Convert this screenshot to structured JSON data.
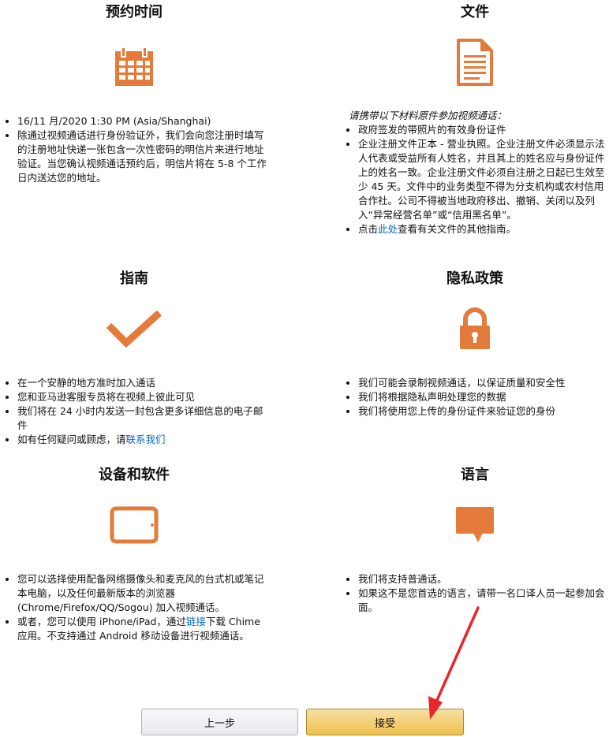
{
  "sections": {
    "appointment": {
      "title": "预约时间",
      "icon": "calendar-icon",
      "items": [
        "16/11 月/2020 1:30 PM (Asia/Shanghai)",
        "除通过视频通话进行身份验证外，我们会向您注册时填写的注册地址快递一张包含一次性密码的明信片来进行地址验证。当您确认视频通话预约后，明信片将在 5-8 个工作日内送达您的地址。"
      ]
    },
    "documents": {
      "title": "文件",
      "icon": "document-icon",
      "intro": "请携带以下材料原件参加视频通话：",
      "items": [
        "政府签发的带照片的有效身份证件",
        "企业注册文件正本 - 营业执照。企业注册文件必须显示法人代表或受益所有人姓名，并且其上的姓名应与身份证件上的姓名一致。企业注册文件必须自注册之日起已生效至少 45 天。文件中的业务类型不得为分支机构或农村信用合作社。公司不得被当地政府移出、撤销、关闭以及列入“异常经营名单”或“信用黑名单”。"
      ],
      "link_item": {
        "before": "点击",
        "link": "此处",
        "after": "查看有关文件的其他指南。"
      }
    },
    "guide": {
      "title": "指南",
      "icon": "checkmark-icon",
      "items": [
        "在一个安静的地方准时加入通话",
        "您和亚马逊客服专员将在视频上彼此可见",
        "我们将在 24 小时内发送一封包含更多详细信息的电子邮件"
      ],
      "link_item": {
        "before": "如有任何疑问或顾虑，请",
        "link": "联系我们",
        "after": ""
      }
    },
    "privacy": {
      "title": "隐私政策",
      "icon": "lock-icon",
      "items": [
        "我们可能会录制视频通话，以保证质量和安全性",
        "我们将根据隐私声明处理您的数据",
        "我们将使用您上传的身份证件来验证您的身份"
      ]
    },
    "equipment": {
      "title": "设备和软件",
      "icon": "tablet-icon",
      "items": [
        "您可以选择使用配备网络摄像头和麦克风的台式机或笔记本电脑，以及任何最新版本的浏览器 (Chrome/Firefox/QQ/Sogou) 加入视频通话。"
      ],
      "link_item": {
        "before": "或者，您可以使用 iPhone/iPad，通过",
        "link": "链接",
        "after": "下载 Chime 应用。不支持通过 Android 移动设备进行视频通话。"
      }
    },
    "language": {
      "title": "语言",
      "icon": "speech-bubble-icon",
      "items": [
        "我们将支持普通话。",
        "如果这不是您首选的语言，请带一名口译人员一起参加会面。"
      ]
    }
  },
  "buttons": {
    "prev": "上一步",
    "accept": "接受"
  },
  "colors": {
    "icon_orange": "#e47b3a",
    "link": "#0066c0",
    "annotation_arrow": "#e8262b"
  }
}
